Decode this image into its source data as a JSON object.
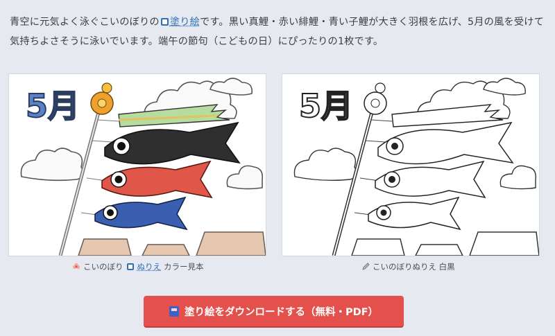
{
  "intro": {
    "line1_prefix": "青空に元気よく泳ぐこいのぼりの",
    "link_text": "塗り絵",
    "line1_suffix": "です。黒い真鯉・赤い緋鯉・青い子鯉が大きく羽根を広げ、5月の風を受けて気持ちよさそうに泳いでいます。端午の節句（こどもの日）にぴったりの1枚です。"
  },
  "color_sample": {
    "heading": "5月",
    "caption_prefix": "こいのぼり",
    "caption_link": "ぬりえ",
    "caption_suffix": "カラー見本"
  },
  "bw_sample": {
    "heading": "5月",
    "caption": "こいのぼりぬりえ 白黒"
  },
  "download": {
    "label": "塗り絵をダウンロードする（無料・PDF）"
  },
  "colors": {
    "button": "#e4504c",
    "link": "#2e6fb8",
    "black_carp": "#2f2f2f",
    "red_carp": "#e0574a",
    "blue_carp": "#3b5fb0",
    "streamer": "#a7cf8f",
    "heading_blue": "#5b82c9"
  }
}
